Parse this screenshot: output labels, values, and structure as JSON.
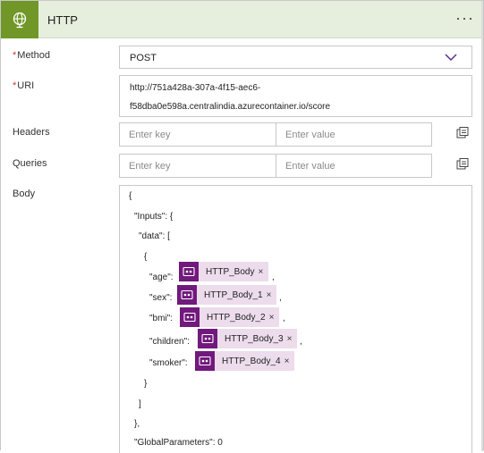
{
  "header": {
    "title": "HTTP",
    "more_label": "···",
    "icon": "globe-icon",
    "accent_color": "#709727",
    "background_color": "#e6eedd"
  },
  "fields": {
    "method": {
      "label": "Method",
      "required_mark": "*",
      "value": "POST"
    },
    "uri": {
      "label": "URI",
      "required_mark": "*",
      "value_line1": "http://751a428a-307a-4f15-aec6-",
      "value_line2": "f58dba0e598a.centralindia.azurecontainer.io/score"
    },
    "headers": {
      "label": "Headers",
      "key_placeholder": "Enter key",
      "value_placeholder": "Enter value"
    },
    "queries": {
      "label": "Queries",
      "key_placeholder": "Enter key",
      "value_placeholder": "Enter value"
    },
    "body": {
      "label": "Body"
    }
  },
  "body_code": {
    "open_brace": "{",
    "inputs_key": "\"Inputs\": {",
    "data_key": "\"data\": [",
    "inner_open": "{",
    "age_key": "\"age\":",
    "sex_key": "\"sex\":",
    "bmi_key": "\"bmi\":",
    "children_key": "\"children\":",
    "smoker_key": "\"smoker\":",
    "comma": ",",
    "inner_close": "}",
    "array_close": "]",
    "inputs_close": "},",
    "global_params": "\"GlobalParameters\": 0"
  },
  "tokens": {
    "age": "HTTP_Body",
    "sex": "HTTP_Body_1",
    "bmi": "HTTP_Body_2",
    "children": "HTTP_Body_3",
    "smoker": "HTTP_Body_4",
    "remove_label": "×",
    "icon": "http-token-icon",
    "token_color": "#71197c"
  }
}
